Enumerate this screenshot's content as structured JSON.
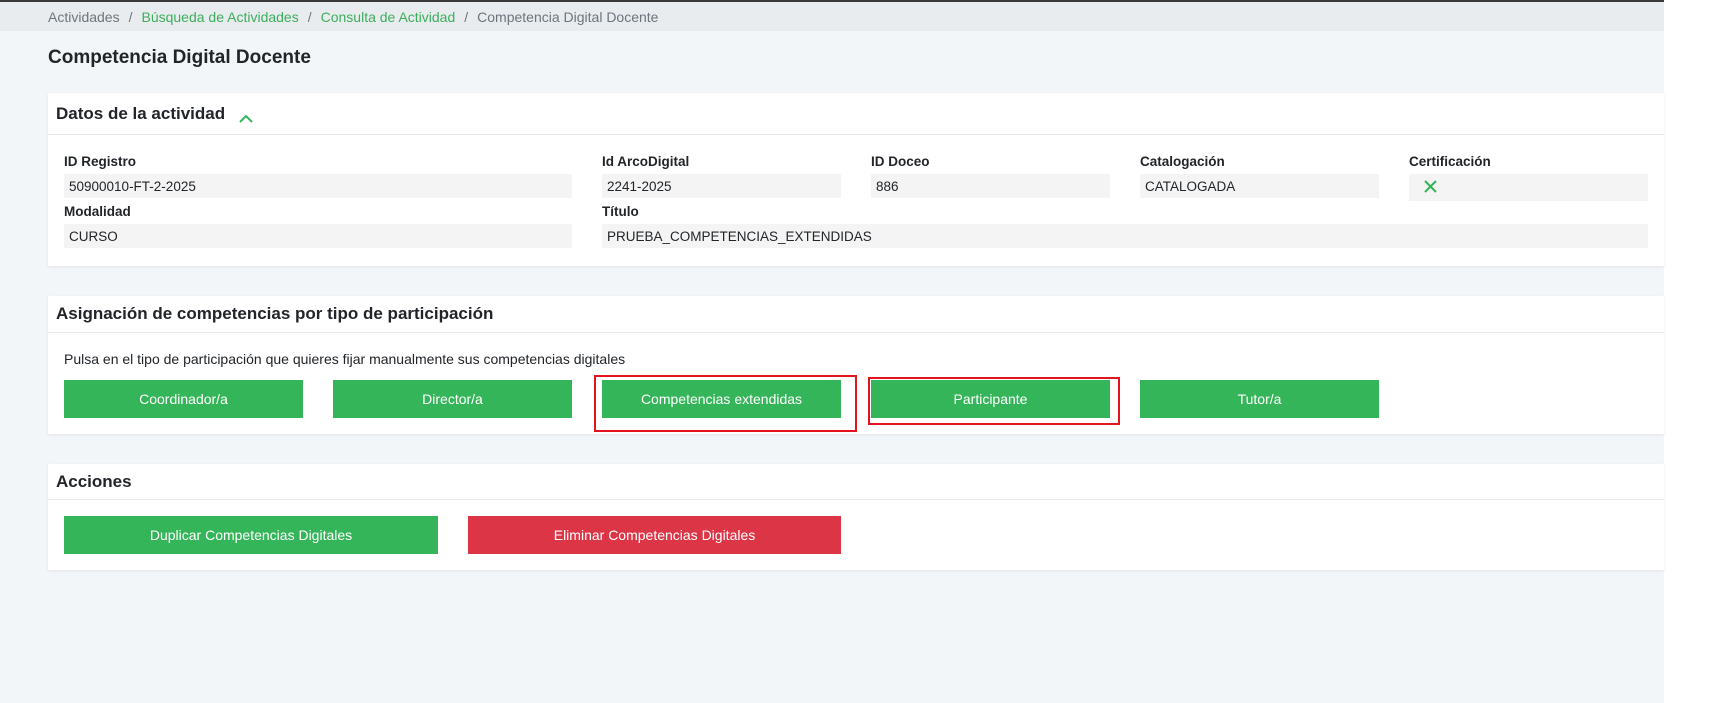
{
  "breadcrumb": {
    "items": [
      "Actividades",
      "Búsqueda de Actividades",
      "Consulta de Actividad",
      "Competencia Digital Docente"
    ],
    "separator": "/"
  },
  "page_title": "Competencia Digital Docente",
  "datos": {
    "header": "Datos de la actividad",
    "id_registro_label": "ID Registro",
    "id_registro_value": "50900010-FT-2-2025",
    "id_arco_label": "Id ArcoDigital",
    "id_arco_value": "2241-2025",
    "id_doceo_label": "ID Doceo",
    "id_doceo_value": "886",
    "catalogacion_label": "Catalogación",
    "catalogacion_value": "CATALOGADA",
    "certificacion_label": "Certificación",
    "certificacion_icon": "x-icon",
    "modalidad_label": "Modalidad",
    "modalidad_value": "CURSO",
    "titulo_label": "Título",
    "titulo_value": "PRUEBA_COMPETENCIAS_EXTENDIDAS"
  },
  "asignacion": {
    "header": "Asignación de competencias por tipo de participación",
    "description": "Pulsa en el tipo de participación que quieres fijar manualmente sus competencias digitales",
    "buttons": [
      "Coordinador/a",
      "Director/a",
      "Competencias extendidas",
      "Participante",
      "Tutor/a"
    ]
  },
  "acciones": {
    "header": "Acciones",
    "duplicar": "Duplicar Competencias Digitales",
    "eliminar": "Eliminar Competencias Digitales"
  },
  "colors": {
    "accent_green": "#35b559",
    "danger_red": "#dc3545",
    "highlight_red": "#e3141e",
    "link_green": "#3cae5c"
  }
}
